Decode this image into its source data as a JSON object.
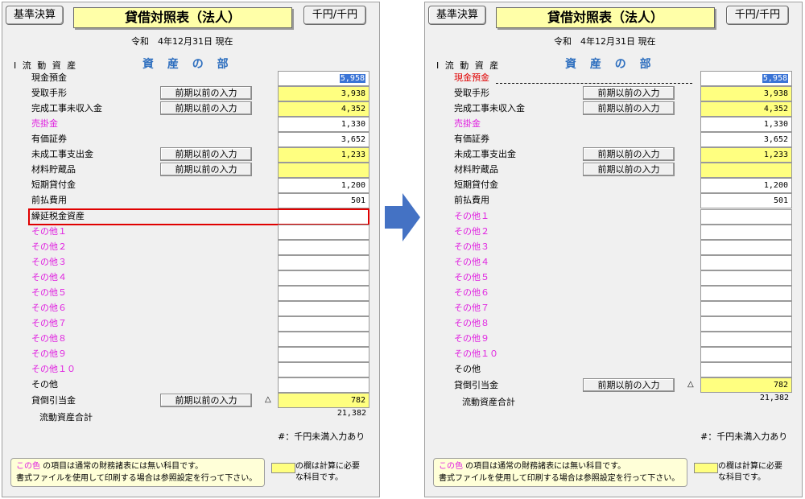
{
  "header": {
    "left_button": "基準決算",
    "title": "貸借対照表（法人）",
    "unit_button": "千円/千円",
    "date_label": "令和　4年12月31日 現在",
    "section_category": "Ⅰ 流 動 資 産",
    "section_label": "資 産 の 部"
  },
  "input_button_label": "前期以前の入力",
  "left_rows": [
    {
      "label": "現金預金",
      "value": "5,958"
    },
    {
      "label": "受取手形",
      "value": "3,938"
    },
    {
      "label": "完成工事未収入金",
      "value": "4,352"
    },
    {
      "label": "売掛金",
      "value": "1,330"
    },
    {
      "label": "有価証券",
      "value": "3,652"
    },
    {
      "label": "未成工事支出金",
      "value": "1,233"
    },
    {
      "label": "材料貯蔵品",
      "value": ""
    },
    {
      "label": "短期貸付金",
      "value": "1,200"
    },
    {
      "label": "前払費用",
      "value": "501"
    },
    {
      "label": "繰延税金資産",
      "value": ""
    },
    {
      "label": "その他１",
      "value": ""
    },
    {
      "label": "その他２",
      "value": ""
    },
    {
      "label": "その他３",
      "value": ""
    },
    {
      "label": "その他４",
      "value": ""
    },
    {
      "label": "その他５",
      "value": ""
    },
    {
      "label": "その他６",
      "value": ""
    },
    {
      "label": "その他７",
      "value": ""
    },
    {
      "label": "その他８",
      "value": ""
    },
    {
      "label": "その他９",
      "value": ""
    },
    {
      "label": "その他１０",
      "value": ""
    },
    {
      "label": "その他",
      "value": ""
    },
    {
      "label": "貸倒引当金",
      "value": "782"
    }
  ],
  "right_rows": [
    {
      "label": "現金預金",
      "value": "5,958"
    },
    {
      "label": "受取手形",
      "value": "3,938"
    },
    {
      "label": "完成工事未収入金",
      "value": "4,352"
    },
    {
      "label": "売掛金",
      "value": "1,330"
    },
    {
      "label": "有価証券",
      "value": "3,652"
    },
    {
      "label": "未成工事支出金",
      "value": "1,233"
    },
    {
      "label": "材料貯蔵品",
      "value": ""
    },
    {
      "label": "短期貸付金",
      "value": "1,200"
    },
    {
      "label": "前払費用",
      "value": "501"
    },
    {
      "label": "その他１",
      "value": ""
    },
    {
      "label": "その他２",
      "value": ""
    },
    {
      "label": "その他３",
      "value": ""
    },
    {
      "label": "その他４",
      "value": ""
    },
    {
      "label": "その他５",
      "value": ""
    },
    {
      "label": "その他６",
      "value": ""
    },
    {
      "label": "その他７",
      "value": ""
    },
    {
      "label": "その他８",
      "value": ""
    },
    {
      "label": "その他９",
      "value": ""
    },
    {
      "label": "その他１０",
      "value": ""
    },
    {
      "label": "その他",
      "value": ""
    },
    {
      "label": "貸倒引当金",
      "value": "782"
    }
  ],
  "triangle": "△",
  "total": {
    "label": "流動資産合計",
    "value": "21,382"
  },
  "note": "#：千円未満入力あり",
  "legend": {
    "color_word": "この色",
    "line1_rest": " の項目は通常の財務諸表には無い科目です。",
    "line2": "書式ファイルを使用して印刷する場合は参照設定を行って下さい。",
    "swatch_text_1": "の欄は計算に必要",
    "swatch_text_2": "な科目です。"
  },
  "colors": {
    "yellow_cell": "#ffff80",
    "title_bg": "#ffffa8",
    "magenta": "#e020e0",
    "red": "#e00000",
    "section_blue": "#2e6fbf",
    "arrow_blue": "#4472c4"
  },
  "arrow_icon": "arrow-right-icon"
}
